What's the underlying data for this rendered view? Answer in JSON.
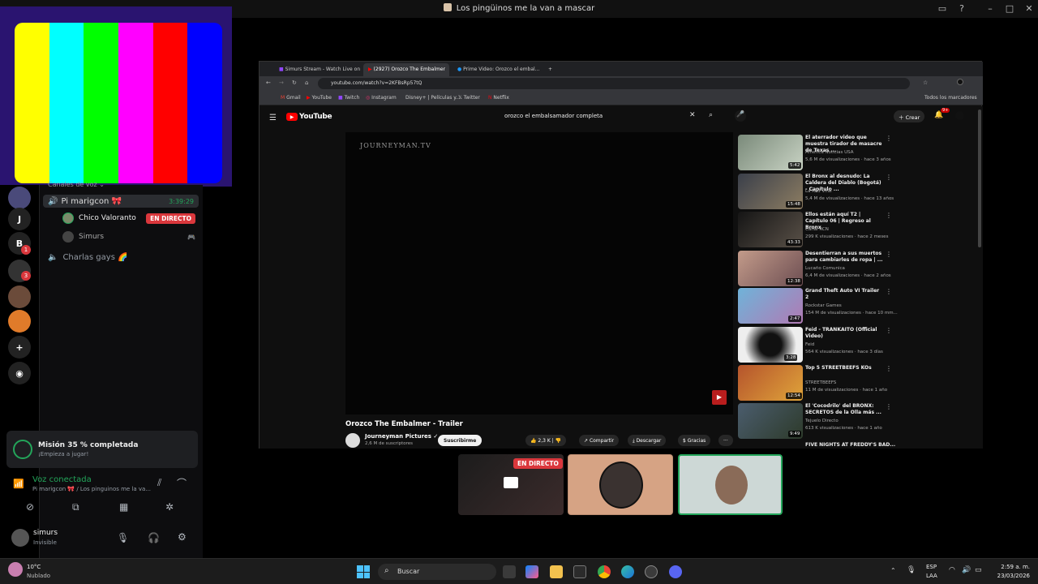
{
  "window": {
    "title": "Los pingüinos me la van a mascar"
  },
  "colors": {
    "discord_red": "#da373c",
    "discord_green": "#23a55a",
    "yt_red": "#ff0000",
    "colorbars": [
      "#ffff00",
      "#00ffff",
      "#00ff00",
      "#ff00ff",
      "#ff0000",
      "#0000ff"
    ]
  },
  "discord": {
    "servers": [
      {
        "label": "",
        "icon": "server-avatar-icon",
        "badge": ""
      },
      {
        "label": "J",
        "icon": "server-j-icon",
        "badge": ""
      },
      {
        "label": "B",
        "icon": "server-b-icon",
        "badge": "1"
      },
      {
        "label": "",
        "icon": "server-avatar-icon",
        "badge": "3"
      },
      {
        "label": "",
        "icon": "server-avatar-icon",
        "badge": ""
      },
      {
        "label": "",
        "icon": "server-avatar-icon",
        "badge": ""
      }
    ],
    "category": "Canales de voz",
    "voice_channel": {
      "name": "Pi marigcon 🎀",
      "timer": "3:39:29"
    },
    "members": [
      {
        "name": "Chico Valoranto",
        "status": "EN DIRECTO"
      },
      {
        "name": "Simurs",
        "status": ""
      }
    ],
    "other_channel": "Charlas gays 🌈",
    "mission": {
      "title": "Misión 35 % completada",
      "subtitle": "¡Empieza a jugar!"
    },
    "voice_status": {
      "title": "Voz conectada",
      "subtitle": "Pi marigcon 🎀 / Los pinguinos me la va..."
    },
    "user": {
      "name": "simurs",
      "status": "Invisible"
    }
  },
  "chrome": {
    "tabs": [
      "Simurs Stream - Watch Live on",
      "(2927) Orozco The Embalmer",
      "Prime Video: Orozco el embal..."
    ],
    "url": "youtube.com/watch?v=2KFBsRp57tQ",
    "bookmarks": [
      "Gmail",
      "YouTube",
      "Twitch",
      "Instagram",
      "Disney+ | Películas y...",
      "Twitter",
      "Netflix"
    ],
    "all_bookmarks": "Todos los marcadores"
  },
  "youtube": {
    "logo": "YouTube",
    "search": "orozco el embalsamador completa",
    "create": "Crear",
    "notif_count": "9+",
    "watermark": "JOURNEYMAN.TV",
    "video_title": "Orozco The Embalmer - Trailer",
    "channel": "Journeyman Pictures",
    "subs": "2,6 M de suscriptores",
    "subscribe": "Suscribirme",
    "likes": "2,3 K",
    "share": "Compartir",
    "download": "Descargar",
    "thanks": "Gracias",
    "recs": [
      {
        "title": "El aterrador video que muestra tirador de masacre de Texas ...",
        "channel": "America Noticias USA",
        "views": "5,6 M de visualizaciones · hace 3 años",
        "dur": "5:42"
      },
      {
        "title": "El Bronx al desnudo: La Caldera del Diablo (Bogotá) - Capítulo ...",
        "channel": "La Red Viral",
        "views": "5,4 M de visualizaciones · hace 13 años",
        "dur": "15:48"
      },
      {
        "title": "Ellos están aquí T2 | Capítulo 06 | Regreso al Bronx",
        "channel": "Canal RCN",
        "views": "299 K visualizaciones · hace 2 meses",
        "dur": "43:33"
      },
      {
        "title": "Desentierran a sus muertos para cambiarles de ropa | ...",
        "channel": "Lucaño Comunica",
        "views": "6,4 M de visualizaciones · hace 2 años",
        "dur": "12:38"
      },
      {
        "title": "Grand Theft Auto VI Trailer 2",
        "channel": "Rockstar Games",
        "views": "154 M de visualizaciones · hace 10 mm...",
        "dur": "2:47"
      },
      {
        "title": "Feid - TRANKAITO (Official Video)",
        "channel": "Feid",
        "views": "564 K visualizaciones · hace 3 días",
        "dur": "3:28"
      },
      {
        "title": "Top 5 STREETBEEFS KOs",
        "channel": "STREETBEEFS",
        "views": "11 M de visualizaciones · hace 1 año",
        "dur": "12:54"
      },
      {
        "title": "El 'Cocodrilo' del BRONX: SECRETOS de la Olla más ...",
        "channel": "Tejuelo Directo",
        "views": "613 K visualizaciones · hace 1 año",
        "dur": "9:49"
      }
    ],
    "next_rec_partial": "FIVE NIGHTS AT FREDDY'S BAD..."
  },
  "stream_tiles": {
    "live": "EN DIRECTO"
  },
  "taskbar": {
    "weather_temp": "10°C",
    "weather_desc": "Nublado",
    "search": "Buscar",
    "lang1": "ESP",
    "lang2": "LAA",
    "time": "2:59 a. m.",
    "date": "23/03/2026"
  }
}
